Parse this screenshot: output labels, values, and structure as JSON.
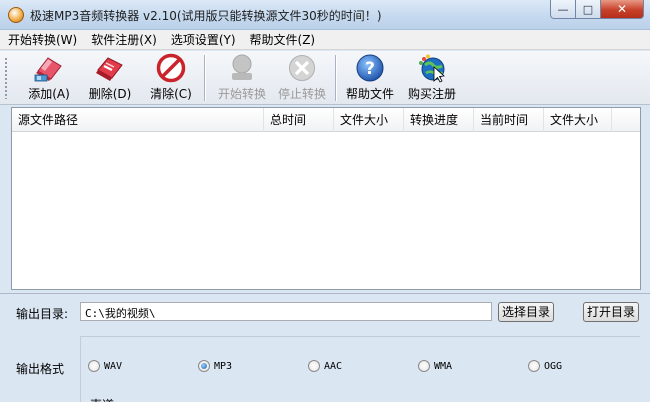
{
  "window": {
    "title": "极速MP3音频转换器 v2.10(试用版只能转换源文件30秒的时间！)",
    "controls": {
      "minimize": "—",
      "maximize": "□",
      "close": "✕"
    }
  },
  "menu": [
    {
      "label": "开始转换(W)"
    },
    {
      "label": "软件注册(X)"
    },
    {
      "label": "选项设置(Y)"
    },
    {
      "label": "帮助文件(Z)"
    }
  ],
  "toolbar": {
    "add": {
      "label": "添加(A)",
      "icon": "add-eraser-icon"
    },
    "delete": {
      "label": "删除(D)",
      "icon": "delete-eraser-icon"
    },
    "clear": {
      "label": "清除(C)",
      "icon": "clear-prohibit-icon"
    },
    "start": {
      "label": "开始转换",
      "icon": "start-convert-icon",
      "enabled": false
    },
    "stop": {
      "label": "停止转换",
      "icon": "stop-convert-icon",
      "enabled": false
    },
    "help": {
      "label": "帮助文件",
      "icon": "help-question-icon"
    },
    "buy": {
      "label": "购买注册",
      "icon": "buy-register-icon"
    }
  },
  "file_list": {
    "columns": [
      "源文件路径",
      "总时间",
      "文件大小",
      "转换进度",
      "当前时间",
      "文件大小"
    ],
    "rows": []
  },
  "output": {
    "dir_label": "输出目录:",
    "dir_value": "C:\\我的视频\\",
    "select_dir_button": "选择目录",
    "open_dir_button": "打开目录"
  },
  "format": {
    "label": "输出格式",
    "options": [
      "WAV",
      "MP3",
      "AAC",
      "WMA",
      "OGG"
    ],
    "selected": "MP3"
  },
  "partial_text": "声道"
}
